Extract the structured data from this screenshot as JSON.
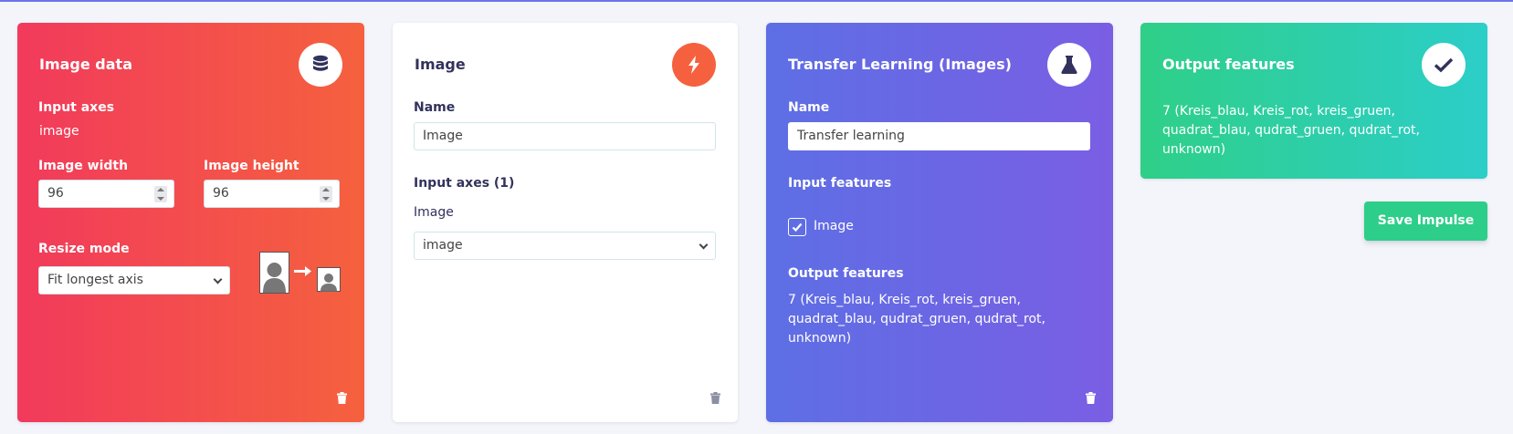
{
  "image_data_block": {
    "title": "Image data",
    "icon": "database-icon",
    "input_axes_label": "Input axes",
    "input_axes_value": "image",
    "image_width_label": "Image width",
    "image_width_value": "96",
    "image_height_label": "Image height",
    "image_height_value": "96",
    "resize_mode_label": "Resize mode",
    "resize_mode_value": "Fit longest axis"
  },
  "processing_block": {
    "title": "Image",
    "icon": "bolt-icon",
    "name_label": "Name",
    "name_value": "Image",
    "input_axes_label": "Input axes (1)",
    "axis_name": "Image",
    "axis_select_value": "image"
  },
  "learning_block": {
    "title": "Transfer Learning (Images)",
    "icon": "flask-icon",
    "name_label": "Name",
    "name_value": "Transfer learning",
    "input_features_label": "Input features",
    "input_feature_checkbox_label": "Image",
    "output_features_label": "Output features",
    "output_features_value": "7 (Kreis_blau, Kreis_rot, kreis_gruen, quadrat_blau, qudrat_gruen, qudrat_rot, unknown)"
  },
  "output_block": {
    "title": "Output features",
    "icon": "check-icon",
    "value": "7 (Kreis_blau, Kreis_rot, kreis_gruen, quadrat_blau, qudrat_gruen, qudrat_rot, unknown)"
  },
  "save_button_label": "Save Impulse",
  "colors": {
    "image_data_gradient": [
      "#f23a5c",
      "#f5613e"
    ],
    "learning_gradient": [
      "#5d6fe4",
      "#7a5ee4"
    ],
    "output_gradient": [
      "#2fcf88",
      "#2ccec9"
    ],
    "save_button": "#2dce89",
    "bolt_circle": "#f5613e"
  }
}
